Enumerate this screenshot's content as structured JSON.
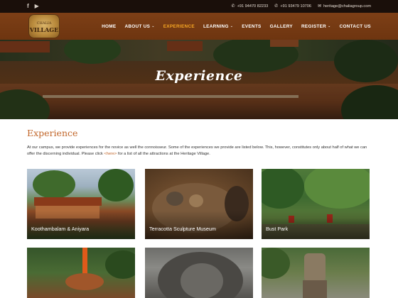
{
  "topbar": {
    "social": {
      "facebook": "f",
      "youtube": "▶"
    },
    "phone1": "+91 94470 82233",
    "phone2": "+91 93479 10706",
    "email": "heritage@chaliagroup.com"
  },
  "nav": {
    "logo_line1": "CHALIA",
    "logo_line2": "VILLAGE",
    "items": [
      {
        "label": "HOME"
      },
      {
        "label": "ABOUT US",
        "dropdown": "⌄"
      },
      {
        "label": "EXPERIENCE",
        "active": true
      },
      {
        "label": "LEARNING",
        "dropdown": "⌄"
      },
      {
        "label": "EVENTS"
      },
      {
        "label": "GALLERY"
      },
      {
        "label": "REGISTER",
        "dropdown": "⌄"
      },
      {
        "label": "CONTACT US"
      }
    ]
  },
  "hero": {
    "title": "Experience"
  },
  "main": {
    "heading": "Experience",
    "intro_before": "At our campus, we provide experiences for the novice as well the connoisseur. Some of the experiences we provide are listed below. This, however, constitutes only about half of what we can offer the discerning individual. Please click ",
    "intro_link": "<here>",
    "intro_after": " for a list of all the attractions at the Heritage Village."
  },
  "cards": [
    {
      "caption": "Koothambalam & Aniyara"
    },
    {
      "caption": "Terracotta Sculpture Museum"
    },
    {
      "caption": "Bust Park"
    },
    {
      "caption": ""
    },
    {
      "caption": ""
    },
    {
      "caption": ""
    }
  ],
  "colors": {
    "accent": "#c1662a",
    "nav_active": "#f5a623",
    "nav_bg": "#7d3f16",
    "topbar_bg": "#1a0f0a"
  }
}
